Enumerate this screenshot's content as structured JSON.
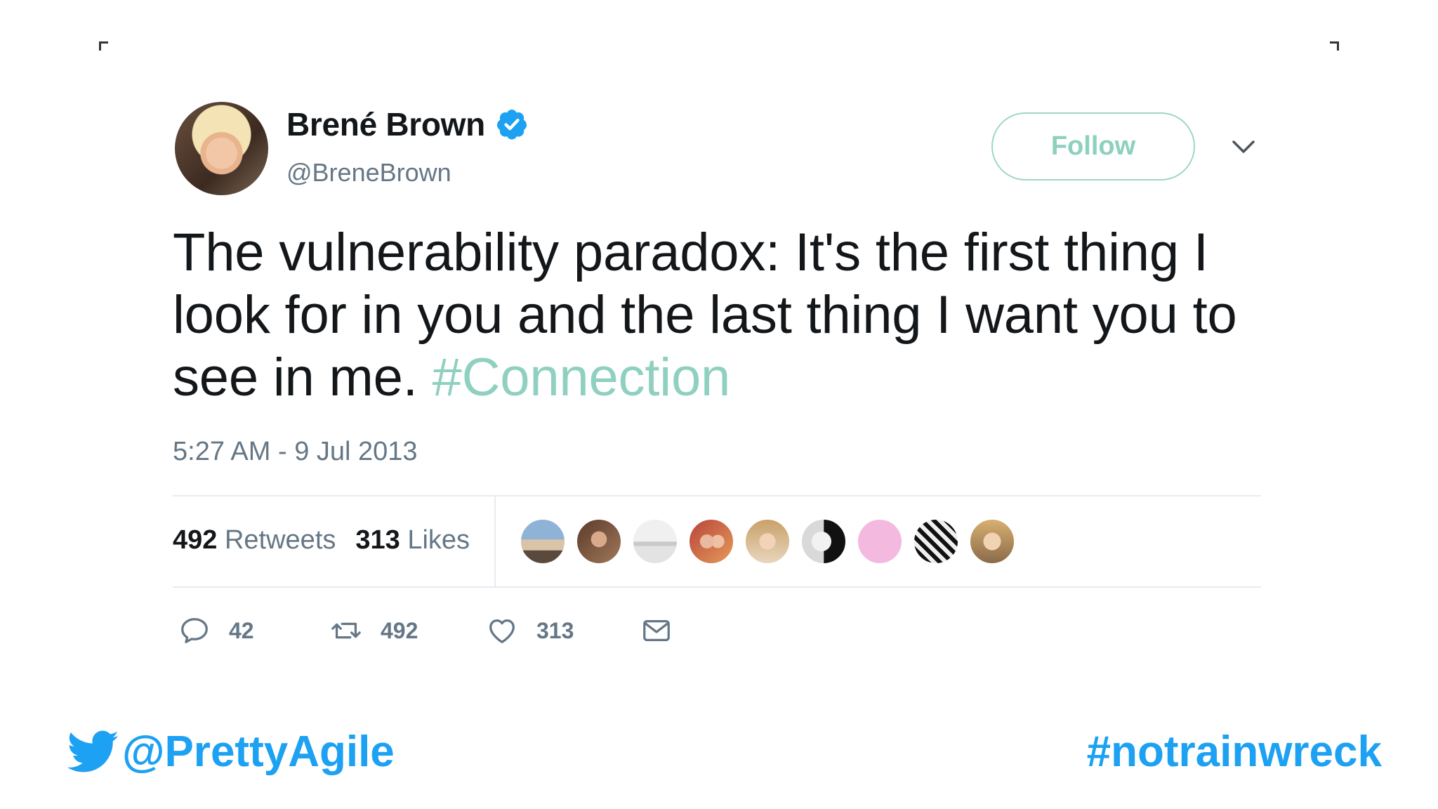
{
  "tweet": {
    "author_name": "Brené Brown",
    "handle": "@BreneBrown",
    "follow_label": "Follow",
    "text_before": "The vulnerability paradox: It's the first thing I look for in you and the last thing I want you to see in me. ",
    "hashtag": "#Connection",
    "timestamp": "5:27 AM - 9 Jul 2013",
    "stats": {
      "retweets_count": "492",
      "retweets_label": "Retweets",
      "likes_count": "313",
      "likes_label": "Likes"
    },
    "actions": {
      "reply_count": "42",
      "retweet_count": "492",
      "like_count": "313"
    },
    "liker_avatars": [
      "liker-1",
      "liker-2",
      "liker-3",
      "liker-4",
      "liker-5",
      "liker-6",
      "liker-7",
      "liker-8",
      "liker-9"
    ],
    "icons": {
      "verified": "verified-badge-icon",
      "caret": "chevron-down-icon",
      "reply": "reply-icon",
      "retweet": "retweet-icon",
      "like": "heart-icon",
      "message": "envelope-icon"
    },
    "colors": {
      "verified": "#1da1f2",
      "follow_accent": "#8dd0be",
      "hashtag": "#8fd0c0",
      "muted": "#657786"
    }
  },
  "footer": {
    "handle": "@PrettyAgile",
    "hashtag": "#notrainwreck",
    "icon": "twitter-bird-icon",
    "color": "#1da1f2"
  }
}
